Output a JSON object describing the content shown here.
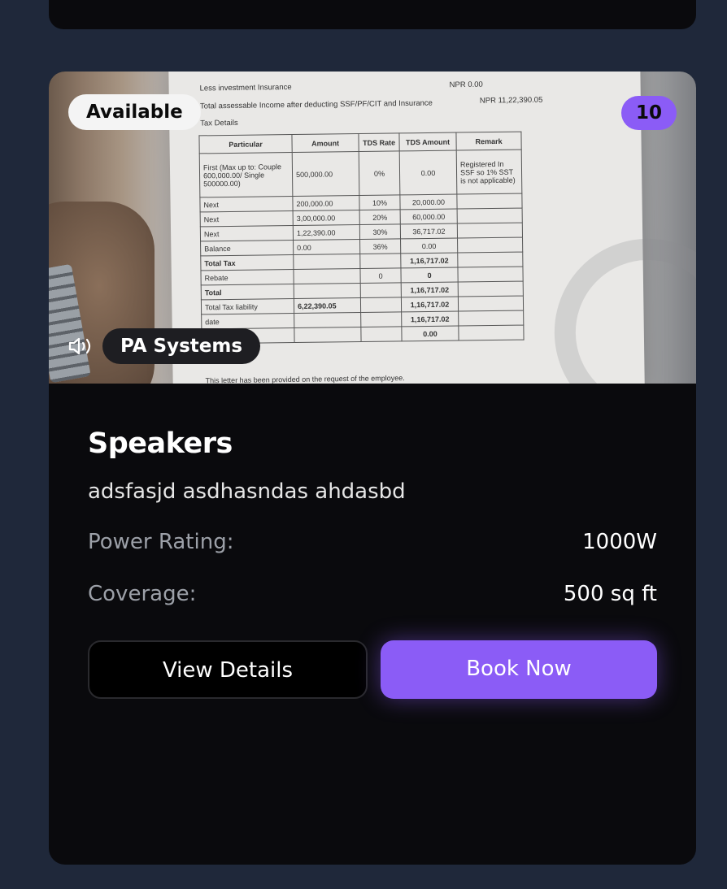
{
  "card": {
    "status_badge": "Available",
    "count_badge": "10",
    "category": "PA Systems",
    "category_icon": "speaker-icon",
    "title": "Speakers",
    "description": "adsfasjd asdhasndas ahdasbd",
    "specs": [
      {
        "label": "Power Rating:",
        "value": "1000W"
      },
      {
        "label": "Coverage:",
        "value": "500 sq ft"
      }
    ],
    "buttons": {
      "view": "View Details",
      "book": "Book Now"
    },
    "colors": {
      "accent": "#8b5cf6",
      "background": "#1f283a",
      "card": "#0a0a0d"
    }
  },
  "photo_document": {
    "line1": "Less investment Insurance",
    "line1_value": "NPR 0.00",
    "line2": "Total assessable Income after deducting SSF/PF/CIT and Insurance",
    "line2_value": "NPR 11,22,390.05",
    "line3": "Tax Details",
    "headers": [
      "Particular",
      "Amount",
      "TDS Rate",
      "TDS Amount",
      "Remark"
    ],
    "rows": [
      [
        "First (Max up to: Couple 600,000.00/ Single 500000.00)",
        "500,000.00",
        "0%",
        "0.00",
        "Registered In SSF so 1% SST is not applicable)"
      ],
      [
        "Next",
        "200,000.00",
        "10%",
        "20,000.00",
        ""
      ],
      [
        "Next",
        "3,00,000.00",
        "20%",
        "60,000.00",
        ""
      ],
      [
        "Next",
        "1,22,390.00",
        "30%",
        "36,717.02",
        ""
      ],
      [
        "Balance",
        "0.00",
        "36%",
        "0.00",
        ""
      ],
      [
        "Total Tax",
        "",
        "",
        "1,16,717.02",
        ""
      ],
      [
        "Rebate",
        "",
        "0",
        "0",
        ""
      ],
      [
        "Total",
        "",
        "",
        "1,16,717.02",
        ""
      ],
      [
        "Total Tax liability",
        "6,22,390.05",
        "",
        "1,16,717.02",
        ""
      ],
      [
        "date",
        "",
        "",
        "1,16,717.02",
        ""
      ],
      [
        "x",
        "",
        "",
        "0.00",
        ""
      ]
    ],
    "footer": "This letter has been provided on the request of the employee."
  }
}
